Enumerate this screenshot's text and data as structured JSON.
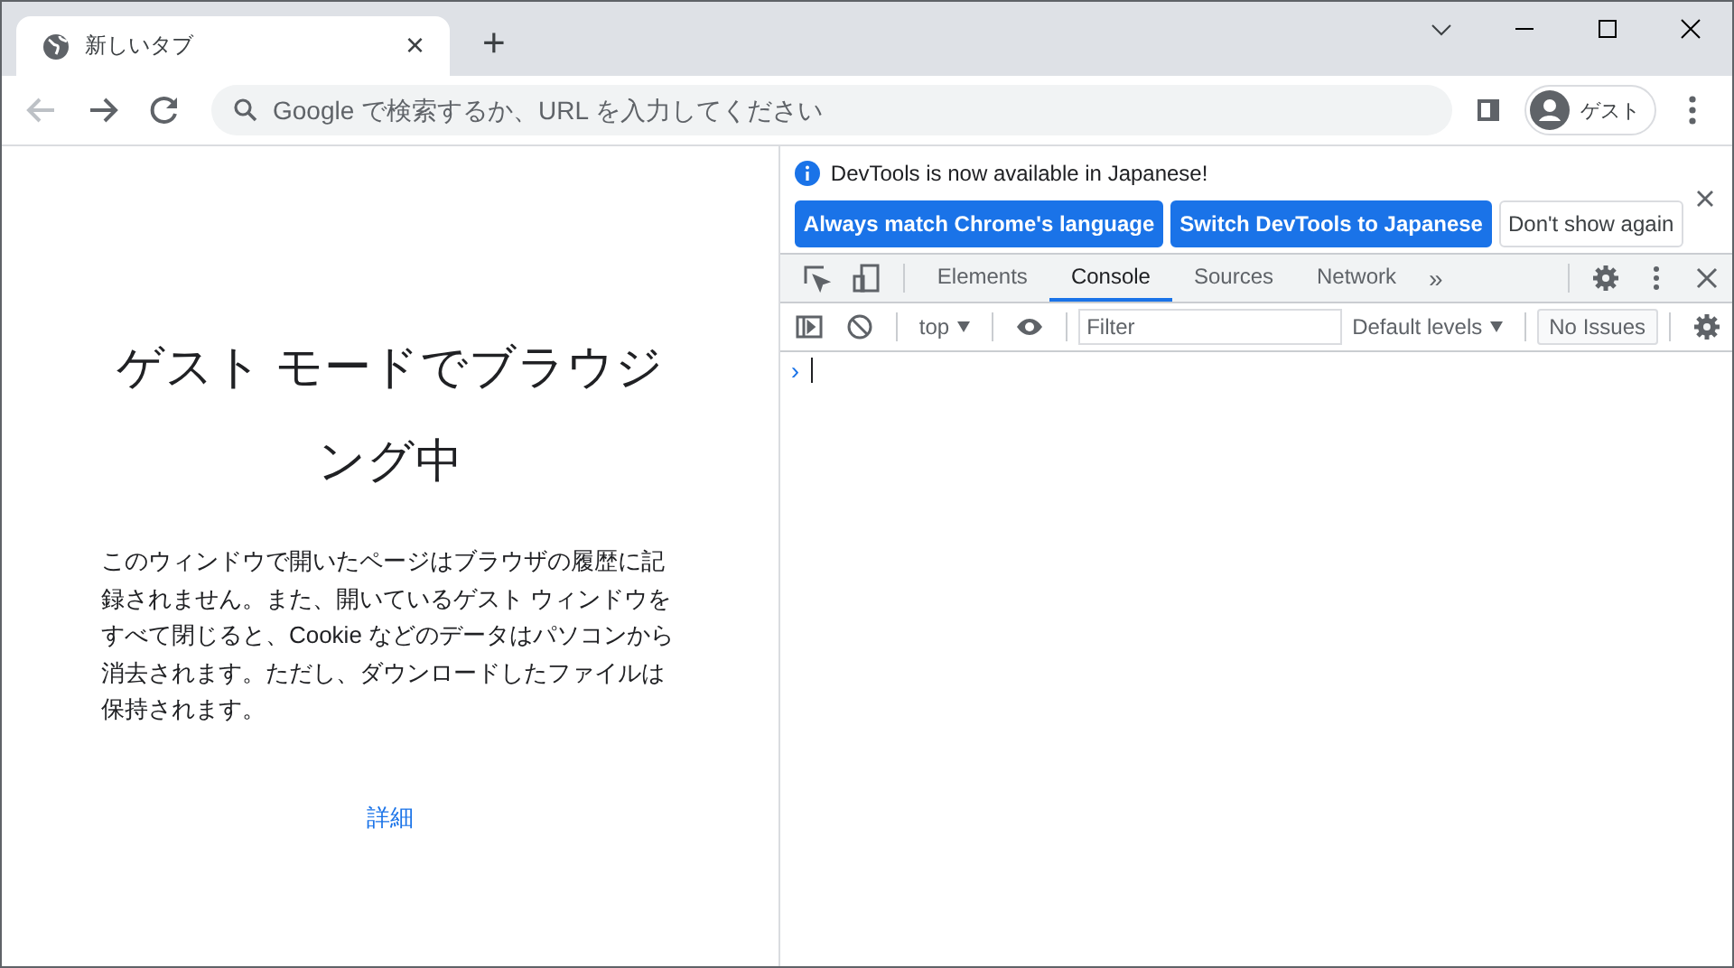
{
  "tab": {
    "title": "新しいタブ",
    "close": "×",
    "new_tab": "+"
  },
  "omnibox": {
    "placeholder": "Google で検索するか、URL を入力してください"
  },
  "profile": {
    "label": "ゲスト"
  },
  "page": {
    "heading": "ゲスト モードでブラウジング中",
    "body": "このウィンドウで開いたページはブラウザの履歴に記録されません。また、開いているゲスト ウィンドウをすべて閉じると、Cookie などのデータはパソコンから消去されます。ただし、ダウンロードしたファイルは保持されます。",
    "link": "詳細"
  },
  "devtools": {
    "infobar": {
      "message": "DevTools is now available in Japanese!",
      "buttons": [
        {
          "label": "Always match Chrome's language",
          "kind": "primary"
        },
        {
          "label": "Switch DevTools to Japanese",
          "kind": "primary"
        },
        {
          "label": "Don't show again",
          "kind": "secondary"
        }
      ]
    },
    "tabs": [
      {
        "label": "Elements",
        "selected": false
      },
      {
        "label": "Console",
        "selected": true
      },
      {
        "label": "Sources",
        "selected": false
      },
      {
        "label": "Network",
        "selected": false
      }
    ],
    "more": "»",
    "context": "top",
    "filter": {
      "placeholder": "Filter"
    },
    "levels": "Default levels",
    "issues": "No Issues",
    "prompt": "›"
  }
}
